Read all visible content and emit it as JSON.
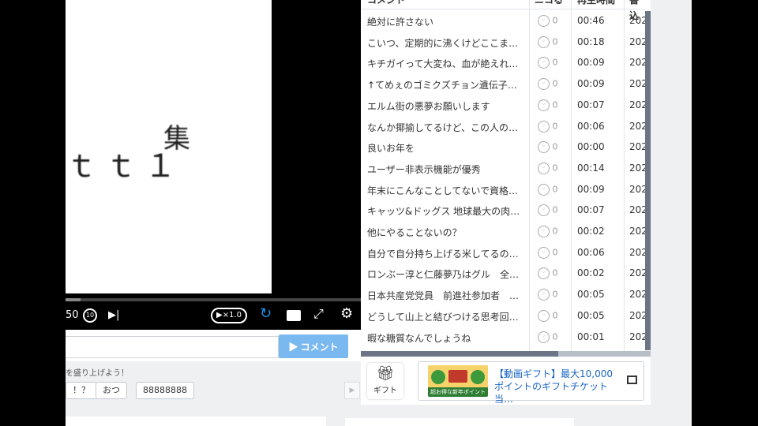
{
  "player": {
    "video_text_main": "ｔｔ１",
    "video_text_sup": "集",
    "time_display": "50",
    "replay_label": "10",
    "next_icon": "▶|",
    "speed_label": "▶×1.0",
    "loop_icon": "↻",
    "fullscreen_icon": "⤢",
    "settings_icon": "⚙",
    "progress_fraction": 0.05
  },
  "comment_input": {
    "value": "",
    "placeholder": "",
    "submit_label": "▶ コメント",
    "hint": "を盛り上げよう！"
  },
  "chips": [
    "！？",
    "おつ",
    "88888888"
  ],
  "comment_list": {
    "headers": {
      "comment": "コメント",
      "nico": "ニコる",
      "time": "再生時間",
      "date": "書込"
    },
    "rows": [
      {
        "comment": "絶対に許さない",
        "nico": "0",
        "time": "00:46",
        "date": "202"
      },
      {
        "comment": "こいつ、定期的に沸くけどここまで…",
        "nico": "0",
        "time": "00:18",
        "date": "202"
      },
      {
        "comment": "キチガイって大変ね、血が絶えれば…",
        "nico": "0",
        "time": "00:09",
        "date": "202"
      },
      {
        "comment": "↑てめぇのゴミクズチョン遺伝子耐…",
        "nico": "0",
        "time": "00:09",
        "date": "202"
      },
      {
        "comment": "エルム街の悪夢お願いします",
        "nico": "0",
        "time": "00:07",
        "date": "202"
      },
      {
        "comment": "なんか揶揄してるけど、この人の活…",
        "nico": "0",
        "time": "00:06",
        "date": "202"
      },
      {
        "comment": "良いお年を",
        "nico": "0",
        "time": "00:00",
        "date": "202"
      },
      {
        "comment": "ユーザー非表示機能が優秀",
        "nico": "0",
        "time": "00:14",
        "date": "202"
      },
      {
        "comment": "年末にこんなことしてないで資格の…",
        "nico": "0",
        "time": "00:09",
        "date": "202"
      },
      {
        "comment": "キャッツ&ドッグス 地球最大の肉球…",
        "nico": "0",
        "time": "00:07",
        "date": "202"
      },
      {
        "comment": "他にやることないの？",
        "nico": "0",
        "time": "00:02",
        "date": "202"
      },
      {
        "comment": "自分で自分持ち上げる米してるの悲…",
        "nico": "0",
        "time": "00:06",
        "date": "202"
      },
      {
        "comment": "ロンぶー淳と仁藤夢乃はグル　全国…",
        "nico": "0",
        "time": "00:02",
        "date": "202"
      },
      {
        "comment": "日本共産党党員　前進社参加者　阿…",
        "nico": "0",
        "time": "00:05",
        "date": "202"
      },
      {
        "comment": "どうして山上と結びつける思考回路…",
        "nico": "0",
        "time": "00:05",
        "date": "202"
      },
      {
        "comment": "暇な糖質なんでしょうね",
        "nico": "0",
        "time": "00:01",
        "date": "202"
      }
    ]
  },
  "gift": {
    "button_label": "ギフト",
    "icon": "gift-icon",
    "banner_text": "【動画ギフト】最大10,000ポイントのギフトチケット当…",
    "banner_image_caption": "超お得な新年ポイント"
  },
  "colors": {
    "accent": "#1e8fe6",
    "submit_button": "#7ab8f0",
    "scrollbar": "#6b7585",
    "banner_link": "#1a66c4"
  }
}
